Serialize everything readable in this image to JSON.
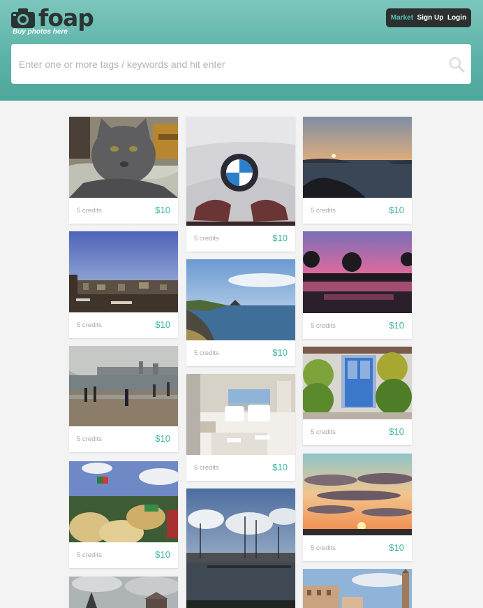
{
  "brand": {
    "name": "foap",
    "tagline": "Buy photos here"
  },
  "nav": {
    "market": "Market",
    "signup": "Sign Up",
    "login": "Login"
  },
  "search": {
    "placeholder": "Enter one or more tags / keywords and hit enter"
  },
  "colors": {
    "accent": "#3db3a5",
    "header": "#5db3a8",
    "nav_bg": "#2c2f2f"
  },
  "photos": [
    {
      "subject": "cat",
      "credits": "5 credits",
      "price": "$10"
    },
    {
      "subject": "bmw",
      "credits": "5 credits",
      "price": "$10"
    },
    {
      "subject": "sea-sunset",
      "credits": "5 credits",
      "price": "$10"
    },
    {
      "subject": "city-skyline",
      "credits": "5 credits",
      "price": "$10"
    },
    {
      "subject": "coast",
      "credits": "5 credits",
      "price": "$10"
    },
    {
      "subject": "pink-lake",
      "credits": "5 credits",
      "price": "$10"
    },
    {
      "subject": "beach-crowd",
      "credits": "5 credits",
      "price": "$10"
    },
    {
      "subject": "bedroom",
      "credits": "5 credits",
      "price": "$10"
    },
    {
      "subject": "blue-door",
      "credits": "5 credits",
      "price": "$10"
    },
    {
      "subject": "sombreros",
      "credits": "5 credits",
      "price": "$10"
    },
    {
      "subject": "sunset-clouds",
      "credits": "5 credits",
      "price": "$10"
    },
    {
      "subject": "harbor",
      "credits": "",
      "price": ""
    },
    {
      "subject": "castle",
      "credits": "",
      "price": ""
    },
    {
      "subject": "venice",
      "credits": "",
      "price": ""
    }
  ]
}
